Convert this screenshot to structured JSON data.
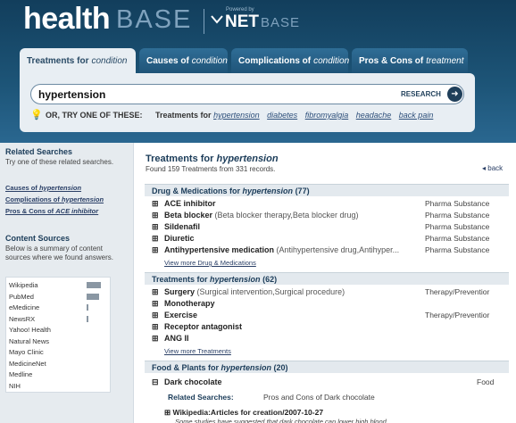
{
  "logo": {
    "main": "health",
    "sub": "BASE",
    "powered": "Powered by",
    "net": "NET",
    "base": "BASE"
  },
  "tabs": [
    {
      "label": "Treatments for",
      "em": "condition"
    },
    {
      "label": "Causes of",
      "em": "condition"
    },
    {
      "label": "Complications of",
      "em": "condition"
    },
    {
      "label": "Pros & Cons of",
      "em": "treatment"
    }
  ],
  "search": {
    "value": "hypertension",
    "button_label": "RESEARCH"
  },
  "suggest": {
    "prefix": "OR, TRY ONE OF THESE:",
    "label": "Treatments for",
    "links": [
      "hypertension",
      "diabetes",
      "fibromyalgia",
      "headache",
      "back pain"
    ]
  },
  "sidebar": {
    "related_title": "Related Searches",
    "related_note": "Try one of these related searches.",
    "related_links": [
      {
        "text": "Causes of",
        "em": "hypertension"
      },
      {
        "text": "Complications of",
        "em": "hypertension"
      },
      {
        "text": "Pros & Cons of",
        "em": "ACE inhibitor"
      }
    ],
    "sources_title": "Content Sources",
    "sources_note": "Below is a summary of content sources where we found answers.",
    "sources": [
      {
        "name": "Wikipedia",
        "level": 0.9
      },
      {
        "name": "PubMed",
        "level": 0.8
      },
      {
        "name": "eMedicine",
        "level": 0.1
      },
      {
        "name": "NewsRX",
        "level": 0.05
      },
      {
        "name": "Yahoo! Health",
        "level": 0.0
      },
      {
        "name": "Natural News",
        "level": 0.0
      },
      {
        "name": "Mayo Clinic",
        "level": 0.0
      },
      {
        "name": "MedicineNet",
        "level": 0.0
      },
      {
        "name": "Medline",
        "level": 0.0
      },
      {
        "name": "NIH",
        "level": 0.0
      }
    ]
  },
  "main": {
    "title": "Treatments for",
    "title_em": "hypertension",
    "subtitle": "Found 159 Treatments from 331 records.",
    "back": "◂ back",
    "sections": [
      {
        "title": "Drug & Medications for",
        "em": "hypertension",
        "count": "(77)",
        "items": [
          {
            "name": "ACE inhibitor",
            "syn": "",
            "type": "Pharma Substance"
          },
          {
            "name": "Beta blocker",
            "syn": "(Beta blocker therapy,Beta blocker drug)",
            "type": "Pharma Substance"
          },
          {
            "name": "Sildenafil",
            "syn": "",
            "type": "Pharma Substance"
          },
          {
            "name": "Diuretic",
            "syn": "",
            "type": "Pharma Substance"
          },
          {
            "name": "Antihypertensive medication",
            "syn": "(Antihypertensive drug,Antihyper...",
            "type": "Pharma Substance"
          }
        ],
        "more": "View more Drug & Medications"
      },
      {
        "title": "Treatments for",
        "em": "hypertension",
        "count": "(62)",
        "items": [
          {
            "name": "Surgery",
            "syn": "(Surgical intervention,Surgical procedure)",
            "type": "Therapy/Preventior"
          },
          {
            "name": "Monotherapy",
            "syn": "",
            "type": ""
          },
          {
            "name": "Exercise",
            "syn": "",
            "type": "Therapy/Preventior"
          },
          {
            "name": "Receptor antagonist",
            "syn": "",
            "type": ""
          },
          {
            "name": "ANG II",
            "syn": "",
            "type": ""
          }
        ],
        "more": "View more Treatments"
      },
      {
        "title": "Food & Plants for",
        "em": "hypertension",
        "count": "(20)",
        "items": [
          {
            "name": "Dark chocolate",
            "syn": "",
            "type": "Food"
          }
        ],
        "more": ""
      }
    ],
    "related_label": "Related Searches:",
    "related_value": "Pros and Cons of Dark chocolate",
    "wiki_title": "Wikipedia:Articles for creation/2007-10-27",
    "wiki_text": "Some studies have suggested that dark chocolate can lower high blood"
  }
}
